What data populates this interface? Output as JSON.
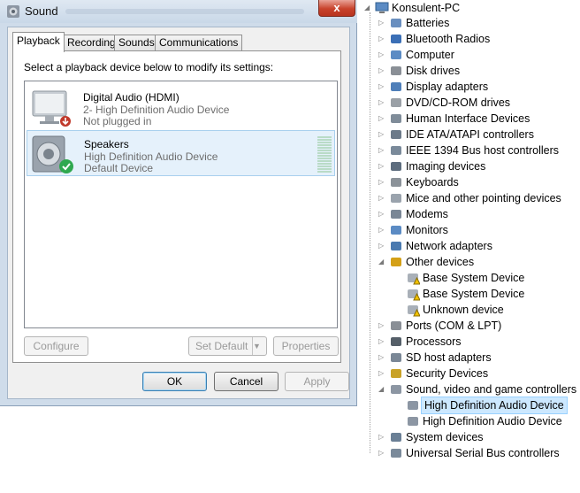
{
  "dialog": {
    "title": "Sound",
    "close_label": "x",
    "tabs": [
      {
        "label": "Playback"
      },
      {
        "label": "Recording"
      },
      {
        "label": "Sounds"
      },
      {
        "label": "Communications"
      }
    ],
    "instruction": "Select a playback device below to modify its settings:",
    "devices": [
      {
        "name": "Digital Audio (HDMI)",
        "line2": "2- High Definition Audio Device",
        "line3": "Not plugged in"
      },
      {
        "name": "Speakers",
        "line2": "High Definition Audio Device",
        "line3": "Default Device"
      }
    ],
    "buttons": {
      "configure": "Configure",
      "set_default": "Set Default",
      "properties": "Properties",
      "ok": "OK",
      "cancel": "Cancel",
      "apply": "Apply"
    }
  },
  "device_manager": {
    "root": "Konsulent-PC",
    "categories": [
      {
        "label": "Batteries",
        "icon": "battery-icon",
        "expanded": false
      },
      {
        "label": "Bluetooth Radios",
        "icon": "bluetooth-icon",
        "expanded": false
      },
      {
        "label": "Computer",
        "icon": "computer-icon",
        "expanded": false
      },
      {
        "label": "Disk drives",
        "icon": "disk-drive-icon",
        "expanded": false
      },
      {
        "label": "Display adapters",
        "icon": "display-adapter-icon",
        "expanded": false
      },
      {
        "label": "DVD/CD-ROM drives",
        "icon": "dvd-icon",
        "expanded": false
      },
      {
        "label": "Human Interface Devices",
        "icon": "hid-icon",
        "expanded": false
      },
      {
        "label": "IDE ATA/ATAPI controllers",
        "icon": "ide-icon",
        "expanded": false
      },
      {
        "label": "IEEE 1394 Bus host controllers",
        "icon": "ieee1394-icon",
        "expanded": false
      },
      {
        "label": "Imaging devices",
        "icon": "camera-icon",
        "expanded": false
      },
      {
        "label": "Keyboards",
        "icon": "keyboard-icon",
        "expanded": false
      },
      {
        "label": "Mice and other pointing devices",
        "icon": "mouse-icon",
        "expanded": false
      },
      {
        "label": "Modems",
        "icon": "modem-icon",
        "expanded": false
      },
      {
        "label": "Monitors",
        "icon": "monitor-icon",
        "expanded": false
      },
      {
        "label": "Network adapters",
        "icon": "network-icon",
        "expanded": false
      },
      {
        "label": "Other devices",
        "icon": "unknown-device-icon",
        "expanded": true,
        "children": [
          {
            "label": "Base System Device",
            "icon": "warning-device-icon"
          },
          {
            "label": "Base System Device",
            "icon": "warning-device-icon"
          },
          {
            "label": "Unknown device",
            "icon": "warning-device-icon"
          }
        ]
      },
      {
        "label": "Ports (COM & LPT)",
        "icon": "port-icon",
        "expanded": false
      },
      {
        "label": "Processors",
        "icon": "processor-icon",
        "expanded": false
      },
      {
        "label": "SD host adapters",
        "icon": "sd-card-icon",
        "expanded": false
      },
      {
        "label": "Security Devices",
        "icon": "security-key-icon",
        "expanded": false
      },
      {
        "label": "Sound, video and game controllers",
        "icon": "speaker-icon",
        "expanded": true,
        "children": [
          {
            "label": "High Definition Audio Device",
            "icon": "speaker-icon",
            "selected": true
          },
          {
            "label": "High Definition Audio Device",
            "icon": "speaker-icon"
          }
        ]
      },
      {
        "label": "System devices",
        "icon": "system-icon",
        "expanded": false
      },
      {
        "label": "Universal Serial Bus controllers",
        "icon": "usb-icon",
        "expanded": false
      }
    ]
  },
  "colors": {
    "dialog_frame": "#cfdcea",
    "selection": "#cce8ff",
    "close_button": "#c8432c"
  }
}
